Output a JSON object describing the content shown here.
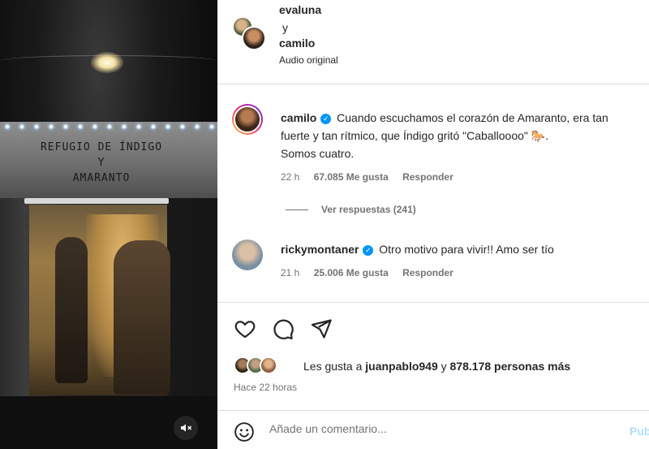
{
  "media": {
    "sign_line1": "REFUGIO DE ÍNDIGO",
    "sign_line2": "Y",
    "sign_line3": "AMARANTO",
    "mute_icon": "speaker-muted-icon"
  },
  "header": {
    "user1": "evaluna",
    "connector": "y",
    "user2": "camilo",
    "audio": "Audio original"
  },
  "comments": [
    {
      "username": "camilo",
      "verified": true,
      "line1": "Cuando escuchamos el corazón de Amaranto, era tan",
      "line2": "fuerte y tan rítmico, que Índigo gritó \"Caballoooo\" 🐎.",
      "line3": "Somos cuatro.",
      "time": "22 h",
      "likes": "67.085 Me gusta",
      "reply": "Responder",
      "view_replies": "Ver respuestas (241)"
    },
    {
      "username": "rickymontaner",
      "verified": true,
      "text": "Otro motivo para vivir!! Amo ser tío",
      "time": "21 h",
      "likes": "25.006 Me gusta",
      "reply": "Responder"
    }
  ],
  "actions": {
    "like_icon": "heart-icon",
    "comment_icon": "comment-icon",
    "share_icon": "send-icon"
  },
  "likes": {
    "prefix": "Les gusta a",
    "user": "juanpablo949",
    "connector": "y",
    "count": "878.178 personas más"
  },
  "post_time": "Hace 22 horas",
  "add_comment": {
    "placeholder": "Añade un comentario...",
    "publish": "Publicar"
  },
  "colors": {
    "link_blue": "#0095f6",
    "muted_text": "#737373",
    "border": "#dbdbdb"
  }
}
